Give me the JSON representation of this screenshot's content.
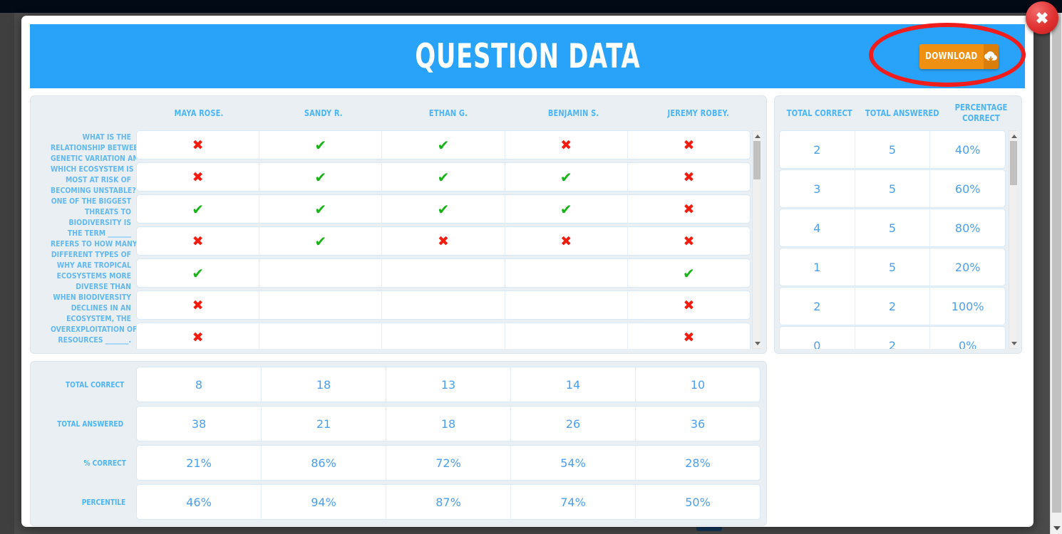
{
  "modal": {
    "title": "QUESTION DATA",
    "download_label": "DOWNLOAD",
    "download_icon": "download-cloud-icon",
    "close_icon": "close-icon"
  },
  "students": [
    "MAYA ROSE.",
    "SANDY R.",
    "ETHAN G.",
    "BENJAMIN S.",
    "JEREMY ROBEY."
  ],
  "questions": [
    {
      "line1": "WHAT IS THE",
      "line2": "RELATIONSHIP BETWEEN",
      "line3": "GENETIC VARIATION AND",
      "marks": [
        "wrong",
        "correct",
        "correct",
        "wrong",
        "wrong"
      ]
    },
    {
      "line1": "WHICH ECOSYSTEM IS",
      "line2": "MOST AT RISK OF",
      "line3": "BECOMING UNSTABLE?",
      "marks": [
        "wrong",
        "correct",
        "correct",
        "correct",
        "wrong"
      ]
    },
    {
      "line1": "ONE OF THE BIGGEST",
      "line2": "THREATS TO",
      "line3": "BIODIVERSITY IS",
      "marks": [
        "correct",
        "correct",
        "correct",
        "correct",
        "wrong"
      ]
    },
    {
      "line1": "THE TERM _______",
      "line2": "REFERS TO HOW MANY",
      "line3": "DIFFERENT TYPES OF",
      "marks": [
        "wrong",
        "correct",
        "wrong",
        "wrong",
        "wrong"
      ]
    },
    {
      "line1": "WHY ARE TROPICAL",
      "line2": "ECOSYSTEMS MORE",
      "line3": "DIVERSE THAN",
      "marks": [
        "correct",
        "",
        "",
        "",
        "correct"
      ]
    },
    {
      "line1": "WHEN BIODIVERSITY",
      "line2": "DECLINES IN AN",
      "line3": "ECOSYSTEM, THE",
      "marks": [
        "wrong",
        "",
        "",
        "",
        "wrong"
      ]
    },
    {
      "line1": "OVEREXPLOITATION OF",
      "line2": "RESOURCES _______.",
      "line3": "",
      "marks": [
        "wrong",
        "",
        "",
        "",
        "wrong"
      ]
    }
  ],
  "summary": {
    "headers": [
      "TOTAL CORRECT",
      "TOTAL ANSWERED",
      "PERCENTAGE CORRECT"
    ],
    "header_percentage_line1": "PERCENTAGE",
    "header_percentage_line2": "CORRECT",
    "rows": [
      {
        "total_correct": "2",
        "total_answered": "5",
        "percentage_correct": "40%"
      },
      {
        "total_correct": "3",
        "total_answered": "5",
        "percentage_correct": "60%"
      },
      {
        "total_correct": "4",
        "total_answered": "5",
        "percentage_correct": "80%"
      },
      {
        "total_correct": "1",
        "total_answered": "5",
        "percentage_correct": "20%"
      },
      {
        "total_correct": "2",
        "total_answered": "2",
        "percentage_correct": "100%"
      },
      {
        "total_correct": "0",
        "total_answered": "2",
        "percentage_correct": "0%"
      }
    ]
  },
  "totals": {
    "rows": [
      {
        "label": "TOTAL CORRECT",
        "values": [
          "8",
          "18",
          "13",
          "14",
          "10"
        ]
      },
      {
        "label": "TOTAL ANSWERED",
        "values": [
          "38",
          "21",
          "18",
          "26",
          "36"
        ]
      },
      {
        "label": "% CORRECT",
        "values": [
          "21%",
          "86%",
          "72%",
          "54%",
          "28%"
        ]
      },
      {
        "label": "PERCENTILE",
        "values": [
          "46%",
          "94%",
          "87%",
          "74%",
          "50%"
        ]
      }
    ]
  },
  "colors": {
    "header_blue": "#28a3f9",
    "accent_blue": "#4db5f7",
    "download_orange": "#ef9013",
    "download_orange_dark": "#d97e0c",
    "annotation_red": "#f11d1d",
    "mark_correct_green": "#19b319",
    "mark_wrong_red": "#f41b0f",
    "panel_bg": "#eaeff3"
  },
  "marks": {
    "correct_glyph": "✔",
    "wrong_glyph": "✖"
  }
}
